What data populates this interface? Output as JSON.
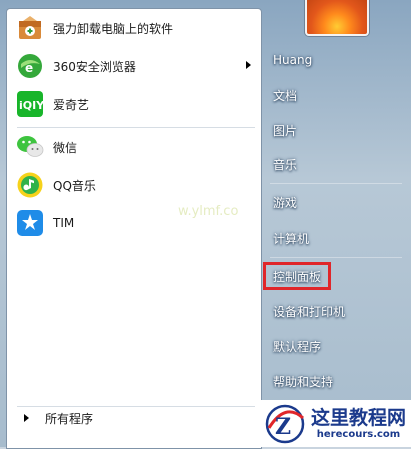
{
  "programs": [
    {
      "label": "强力卸载电脑上的软件",
      "icon": "uninstall-box-icon"
    },
    {
      "label": "360安全浏览器",
      "icon": "360-browser-icon",
      "has_submenu": true
    },
    {
      "label": "爱奇艺",
      "icon": "iqiyi-icon"
    },
    {
      "label": "微信",
      "icon": "wechat-icon"
    },
    {
      "label": "QQ音乐",
      "icon": "qq-music-icon"
    },
    {
      "label": "TIM",
      "icon": "tim-icon"
    }
  ],
  "all_programs": "所有程序",
  "right_items": [
    {
      "label": "Huang"
    },
    {
      "label": "文档"
    },
    {
      "label": "图片"
    },
    {
      "label": "音乐"
    },
    {
      "label": "游戏"
    },
    {
      "label": "计算机"
    },
    {
      "label": "控制面板",
      "highlighted": true
    },
    {
      "label": "设备和打印机"
    },
    {
      "label": "默认程序"
    },
    {
      "label": "帮助和支持"
    }
  ],
  "watermark": {
    "url_text": "w.ylmf.co",
    "site_name": "这里教程网",
    "site_url": "herecours.com"
  },
  "colors": {
    "highlight": "#e0262a",
    "brand_blue": "#1b3a8c"
  }
}
